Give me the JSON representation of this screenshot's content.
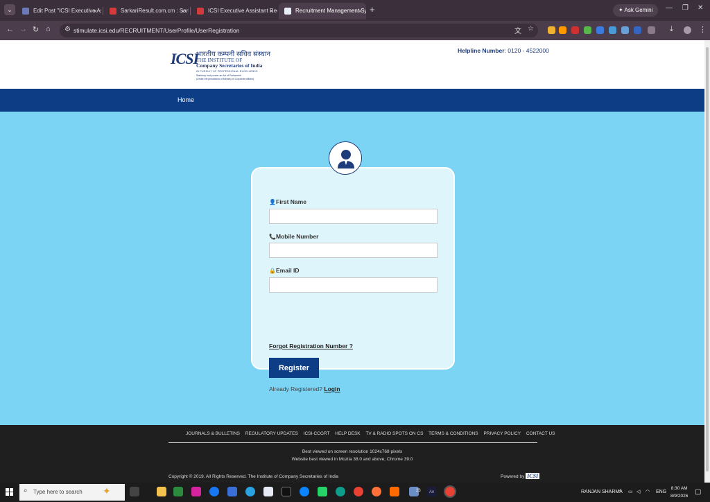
{
  "browser": {
    "tabs": [
      {
        "title": "Edit Post \"ICSI Executive Assista",
        "active": false,
        "favicon_color": "#6c7bb8"
      },
      {
        "title": "SarkariResult.com.cm : Sarkari R",
        "active": false,
        "favicon_color": "#d23b3b"
      },
      {
        "title": "ICSI Executive Assistant Recruitm",
        "active": false,
        "favicon_color": "#d23b3b"
      },
      {
        "title": "Recruitment Management Syste",
        "active": true,
        "favicon_color": "#e8eef8"
      }
    ],
    "tab_close": "×",
    "new_tab": "+",
    "ask_gemini": "Ask Gemini",
    "url": "stimulate.icsi.edu/RECRUITMENT/UserProfile/UserRegistration"
  },
  "site": {
    "logo_mark": "ICSI",
    "logo_hindi": "भारतीय कम्पनी सचिव संस्थान",
    "logo_line1": "THE INSTITUTE OF",
    "logo_line2": "Company Secretaries of India",
    "logo_line3": "IN PURSUIT OF PROFESSIONAL EXCELLENCE",
    "logo_line4": "Statutory body under an Act of Parliament",
    "logo_line5": "(Under the jurisdiction of Ministry of Corporate Affairs)",
    "helpline_label": "Helpline Number",
    "helpline_value": ": 0120 - 4522000",
    "nav_home": "Home"
  },
  "form": {
    "first_name_label": "First Name",
    "first_name_value": "",
    "mobile_label": "Mobile Number",
    "mobile_value": "",
    "email_label": "Email ID",
    "email_value": "",
    "forgot_link": "Forgot Registration Number ?",
    "register_button": "Register",
    "already_text": "Already Registered?",
    "login_link": "Login"
  },
  "footer": {
    "links": [
      "JOURNALS & BULLETINS",
      "REGULATORY UPDATES",
      "ICSI-CCGRT",
      "HELP DESK",
      "TV & RADIO SPOTS ON CS",
      "TERMS & CONDITIONS",
      "PRIVACY POLICY",
      "CONTACT US"
    ],
    "note1": "Best viewed on screen resolution 1024x768 pixels",
    "note2": "Website best viewed in Mozila 38.0 and above, Chrome 39.0",
    "copyright": "Copyright © 2019. All Rights Reserved. The Institute of Company Secretaries of India",
    "powered_by": "Powered by",
    "powered_logo": "ICSI"
  },
  "taskbar": {
    "search_placeholder": "Type here to search",
    "badge": "23",
    "app_label": "An",
    "user": "RANJAN SHARMA",
    "lang": "ENG",
    "time": "8:30 AM",
    "date": "8/9/2026"
  }
}
